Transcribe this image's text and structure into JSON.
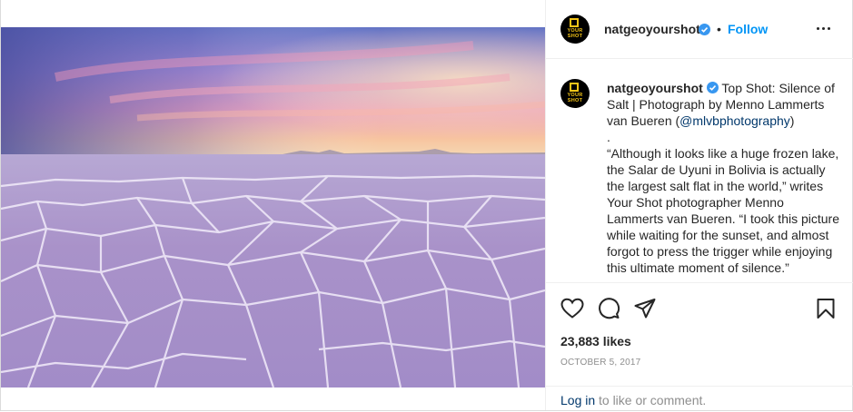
{
  "post": {
    "username": "natgeoyourshot",
    "avatar_text": [
      "YOUR",
      "SHOT"
    ],
    "verified": true,
    "separator": "•",
    "follow_label": "Follow",
    "caption_prefix": " Top Shot: Silence of Salt | Photograph by Menno Lammerts van Bueren (",
    "caption_mention": "@mlvbphotography",
    "caption_after_mention": ")",
    "caption_body": ".\n“Although it looks like a huge frozen lake, the Salar de Uyuni in Bolivia is actually the largest salt flat in the world,” writes Your Shot photographer Menno Lammerts van Bueren. “I took this picture while waiting for the sunset, and almost forgot to press the trigger while enjoying this ultimate moment of silence.”",
    "likes": "23,883 likes",
    "date": "OCTOBER 5, 2017",
    "login_link": "Log in",
    "login_rest": " to like or comment."
  },
  "icons": {
    "more": "more-options-icon",
    "verified": "verified-badge-icon",
    "like": "heart-icon",
    "comment": "comment-icon",
    "share": "share-icon",
    "save": "bookmark-icon"
  },
  "colors": {
    "accent": "#0095f6",
    "verified": "#3897f0",
    "brand_yellow": "#f5c518",
    "text": "#262626",
    "muted": "#8e8e8e",
    "link": "#00376b"
  }
}
